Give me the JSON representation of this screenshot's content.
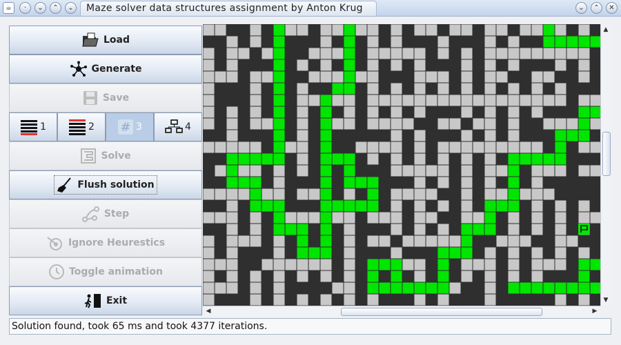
{
  "window": {
    "title": "Maze solver data structures assignment by Anton Krug"
  },
  "buttons": {
    "load": "Load",
    "generate": "Generate",
    "save": "Save",
    "solve": "Solve",
    "flush": "Flush solution",
    "step": "Step",
    "ignore": "Ignore Heurestics",
    "toggle": "Toggle animation",
    "exit": "Exit"
  },
  "structures": [
    {
      "label": "1",
      "icon": "stack-red-bottom-icon"
    },
    {
      "label": "2",
      "icon": "stack-red-top-icon"
    },
    {
      "label": "3",
      "icon": "hash-icon"
    },
    {
      "label": "4",
      "icon": "network-icon"
    }
  ],
  "status": {
    "text": "Solution found, took 65 ms and took 4377 iterations."
  },
  "colors": {
    "path": "#00e600",
    "floor": "#c8c8c8",
    "wall": "#2f2f2f"
  }
}
